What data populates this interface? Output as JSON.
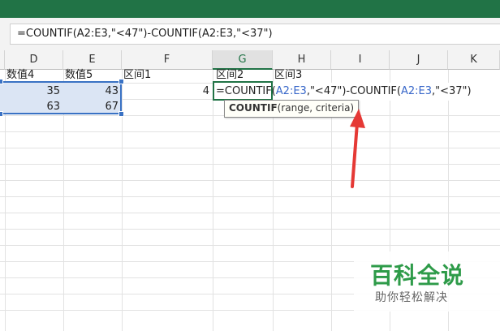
{
  "formula_bar": {
    "value": "=COUNTIF(A2:E3,\"<47\")-COUNTIF(A2:E3,\"<37\")"
  },
  "columns": [
    "D",
    "E",
    "F",
    "G",
    "H",
    "I",
    "J",
    "K"
  ],
  "active_column": "G",
  "row1": {
    "d": "数值4",
    "e": "数值5",
    "f": "区间1",
    "g": "区间2",
    "h": "区间3"
  },
  "row2": {
    "d": "35",
    "e": "43",
    "f": "4"
  },
  "row3": {
    "d": "63",
    "e": "67"
  },
  "edit": {
    "p1": "=COUNTIF(",
    "r1": "A2:E3",
    "p2": ",\"<47\")-COUNTIF(",
    "r2": "A2:E3",
    "p3": ",\"<37\")"
  },
  "tooltip": {
    "fn": "COUNTIF",
    "args": "(range, criteria)"
  },
  "watermark": {
    "title": "百科全说",
    "subtitle": "助你轻松解决"
  },
  "colors": {
    "excel_green": "#217346",
    "selection": "#dbe5f4",
    "ref_blue": "#3867c9",
    "arrow_red": "#e53935",
    "brand_green": "#2e9b49"
  }
}
